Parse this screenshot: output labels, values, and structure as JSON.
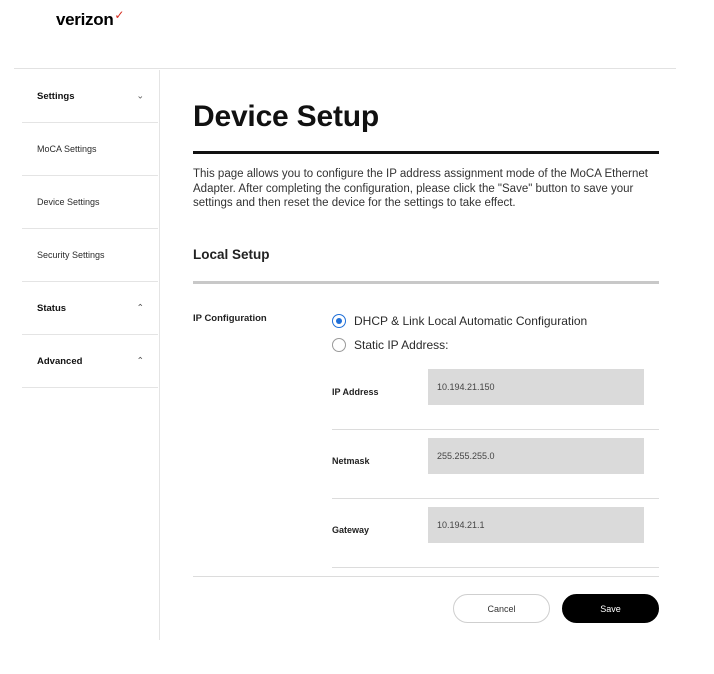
{
  "brand": {
    "name": "verizon",
    "mark": "✓",
    "mark_color": "#d52b1e"
  },
  "sidebar": {
    "items": [
      {
        "label": "Settings",
        "chevron": "chevron-down"
      },
      {
        "label": "MoCA Settings"
      },
      {
        "label": "Device Settings"
      },
      {
        "label": "Security Settings"
      },
      {
        "label": "Status",
        "chevron": "chevron-up"
      },
      {
        "label": "Advanced",
        "chevron": "chevron-up"
      }
    ]
  },
  "main": {
    "title": "Device Setup",
    "description": "This page allows you to configure the IP address assignment mode of the MoCA Ethernet Adapter. After completing the configuration, please click the \"Save\" button to save your settings and then reset the device for the settings to take effect.",
    "section_title": "Local Setup",
    "ip_config": {
      "label": "IP Configuration",
      "options": [
        {
          "label": "DHCP & Link Local Automatic Configuration",
          "selected": true
        },
        {
          "label": "Static IP Address:",
          "selected": false
        }
      ]
    },
    "fields": [
      {
        "label": "IP Address",
        "value": "10.194.21.150"
      },
      {
        "label": "Netmask",
        "value": "255.255.255.0"
      },
      {
        "label": "Gateway",
        "value": "10.194.21.1"
      }
    ],
    "buttons": {
      "cancel": "Cancel",
      "save": "Save"
    }
  },
  "colors": {
    "accent": "#1f6fd8",
    "input_bg": "#dadada",
    "save_bg": "#000000"
  }
}
